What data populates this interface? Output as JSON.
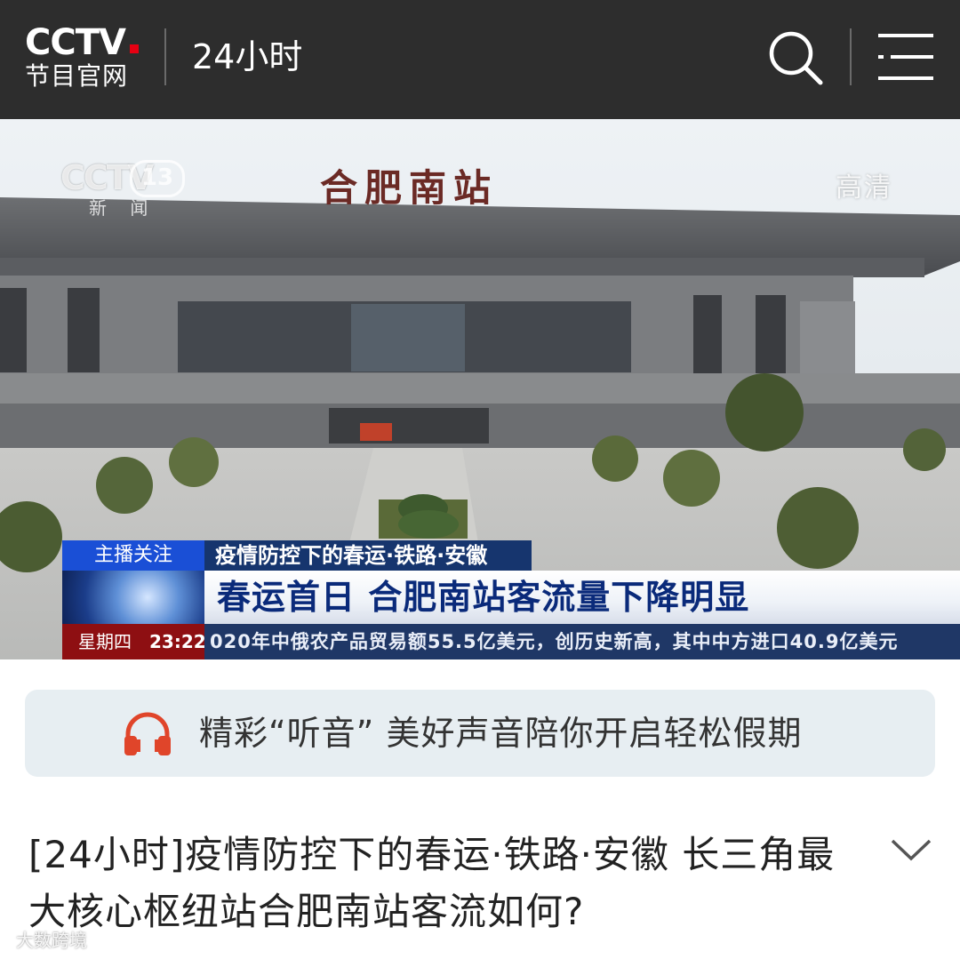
{
  "header": {
    "logo_text": "CCTV",
    "logo_subtitle": "节目官网",
    "section_title": "24小时",
    "icons": [
      "search-icon",
      "menu-icon"
    ]
  },
  "video": {
    "channel_watermark": "CCTV",
    "channel_number": "13",
    "channel_name": "新 闻",
    "quality_badge": "高清",
    "station_sign": "合肥南站",
    "overlay": {
      "tag": "主播关注",
      "topic": "疫情防控下的春运·铁路·安徽",
      "headline": "春运首日 合肥南站客流量下降明显",
      "weekday": "星期四",
      "time": "23:22",
      "ticker": "020年中俄农产品贸易额55.5亿美元，创历史新高，其中中方进口40.9亿美元"
    }
  },
  "audio_banner": {
    "icon": "headphones-icon",
    "text": "精彩“听音” 美好声音陪你开启轻松假期"
  },
  "article": {
    "title": "[24小时]疫情防控下的春运·铁路·安徽 长三角最大核心枢纽站合肥南站客流如何?"
  },
  "watermark": "大数跨境",
  "colors": {
    "header_bg": "#2d2d2d",
    "accent_red": "#e60012",
    "banner_bg": "#e7eef2",
    "news_blue": "#1a4fd6",
    "news_navy": "#16356e",
    "news_red": "#8e0f12"
  }
}
